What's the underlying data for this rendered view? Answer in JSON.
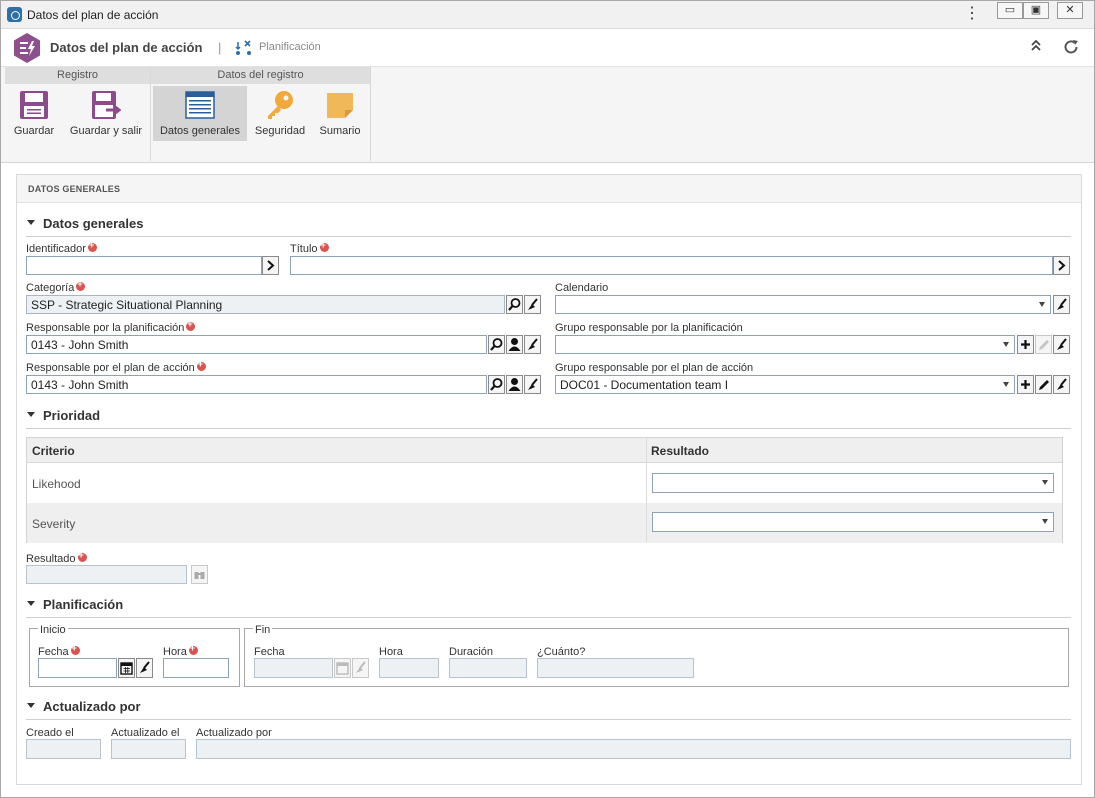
{
  "window": {
    "title": "Datos del plan de acción",
    "controls": [
      "minimize",
      "restore",
      "close"
    ]
  },
  "header": {
    "title": "Datos del plan de acción",
    "breadcrumb_separator": "|",
    "breadcrumb": "Planificación"
  },
  "ribbon": {
    "groups": [
      {
        "label": "Registro"
      },
      {
        "label": "Datos del registro"
      }
    ],
    "buttons": {
      "save": "Guardar",
      "save_exit": "Guardar y salir",
      "general": "Datos generales",
      "security": "Seguridad",
      "summary": "Sumario"
    }
  },
  "panel": {
    "heading": "DATOS GENERALES"
  },
  "sections": {
    "general": "Datos generales",
    "priority": "Prioridad",
    "planning": "Planificación",
    "updated": "Actualizado por"
  },
  "fields": {
    "identifier": {
      "label": "Identificador",
      "value": ""
    },
    "title": {
      "label": "Título",
      "value": ""
    },
    "category": {
      "label": "Categoría",
      "value": "SSP - Strategic Situational Planning"
    },
    "calendar": {
      "label": "Calendario",
      "value": ""
    },
    "planning_owner": {
      "label": "Responsable por la planificación",
      "value": "0143 - John Smith"
    },
    "planning_group": {
      "label": "Grupo responsable por la planificación",
      "value": ""
    },
    "plan_owner": {
      "label": "Responsable por el plan de acción",
      "value": "0143 - John Smith"
    },
    "plan_group": {
      "label": "Grupo responsable por el plan de acción",
      "value": "DOC01 - Documentation team I"
    }
  },
  "priority_grid": {
    "columns": [
      "Criterio",
      "Resultado"
    ],
    "rows": [
      {
        "criterion": "Likehood",
        "result": ""
      },
      {
        "criterion": "Severity",
        "result": ""
      }
    ]
  },
  "result": {
    "label": "Resultado",
    "value": ""
  },
  "planning": {
    "start_legend": "Inicio",
    "end_legend": "Fin",
    "start_date_label": "Fecha",
    "start_time_label": "Hora",
    "end_date_label": "Fecha",
    "end_time_label": "Hora",
    "duration_label": "Duración",
    "howmuch_label": "¿Cuánto?"
  },
  "updated_by": {
    "created_label": "Creado el",
    "updated_on_label": "Actualizado el",
    "updated_by_label": "Actualizado por"
  },
  "colors": {
    "hex_icon": "#8e4f8f",
    "save_icon": "#8d4a8d",
    "key_icon": "#f0a93a",
    "summary_icon": "#f1b85a",
    "required": "#d9534f"
  }
}
